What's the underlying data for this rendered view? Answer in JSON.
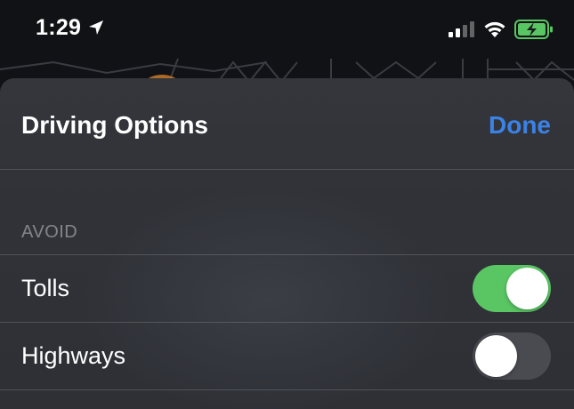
{
  "status_bar": {
    "time": "1:29",
    "battery_color": "#5ac563",
    "icons": [
      "location-arrow-icon",
      "signal-icon",
      "wifi-icon",
      "battery-charging-icon"
    ]
  },
  "sheet": {
    "title": "Driving Options",
    "done_label": "Done",
    "section_header": "AVOID",
    "options": [
      {
        "label": "Tolls",
        "enabled": true
      },
      {
        "label": "Highways",
        "enabled": false
      }
    ]
  },
  "colors": {
    "accent": "#3b82e6",
    "toggle_on": "#5ac563",
    "toggle_off": "#4a4b50",
    "sheet_bg": "#303238"
  }
}
